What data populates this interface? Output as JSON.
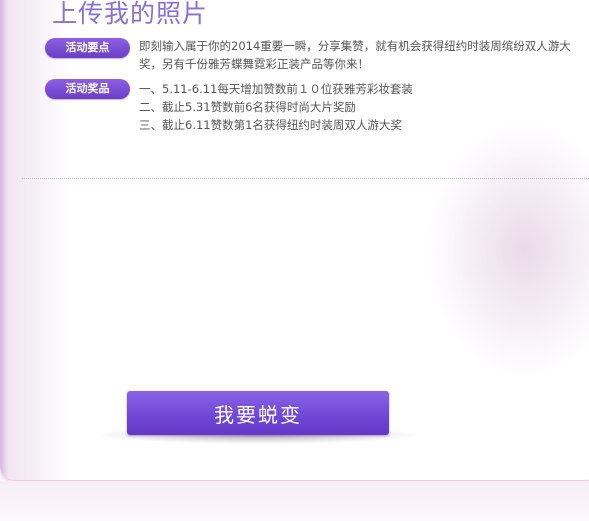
{
  "header": {
    "title": "上传我的照片"
  },
  "activity": {
    "points_label": "活动要点",
    "points_text": "即刻输入属于你的2014重要一瞬，分享集赞，就有机会获得纽约时装周缤纷双人游大奖，另有千份雅芳蝶舞霓彩正装产品等你来！",
    "prizes_label": "活动奖品",
    "prizes": [
      "一、5.11-6.11每天增加赞数前１０位获雅芳彩妆套装",
      "二、截止5.31赞数前6名获得时尚大片奖励",
      "三、截止6.11赞数第1名获得纽约时装周双人游大奖"
    ]
  },
  "cta": {
    "label": "我要蜕变"
  }
}
